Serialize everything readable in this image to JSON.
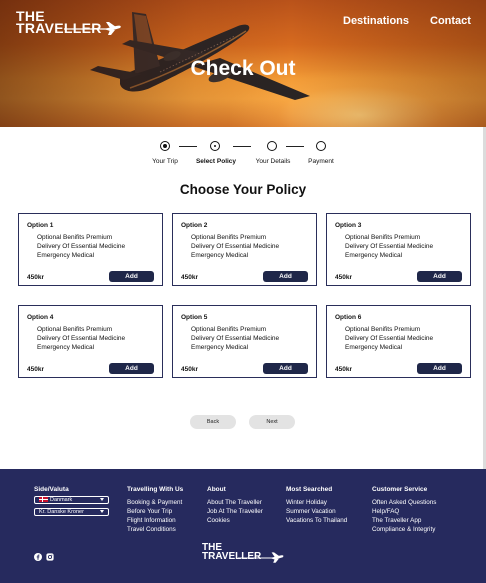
{
  "brand": {
    "line1": "THE",
    "line2": "TRAVELLER"
  },
  "nav": {
    "destinations": "Destinations",
    "contact": "Contact"
  },
  "hero": {
    "title": "Check Out"
  },
  "steps": [
    {
      "label": "Your Trip",
      "state": "done"
    },
    {
      "label": "Select Policy",
      "state": "current"
    },
    {
      "label": "Your Details",
      "state": "todo"
    },
    {
      "label": "Payment",
      "state": "todo"
    }
  ],
  "section_title": "Choose Your Policy",
  "options": [
    {
      "title": "Option 1",
      "features": [
        "Optional Benifits Premium",
        "Delivery Of Essential Medicine",
        "Emergency Medical"
      ],
      "price": "450kr",
      "button": "Add"
    },
    {
      "title": "Option 2",
      "features": [
        "Optional Benifits Premium",
        "Delivery Of Essential Medicine",
        "Emergency Medical"
      ],
      "price": "450kr",
      "button": "Add"
    },
    {
      "title": "Option 3",
      "features": [
        "Optional Benifits Premium",
        "Delivery Of Essential Medicine",
        "Emergency Medical"
      ],
      "price": "450kr",
      "button": "Add"
    },
    {
      "title": "Option 4",
      "features": [
        "Optional Benifits Premium",
        "Delivery Of Essential Medicine",
        "Emergency Medical"
      ],
      "price": "450kr",
      "button": "Add"
    },
    {
      "title": "Option 5",
      "features": [
        "Optional Benifits Premium",
        "Delivery Of Essential Medicine",
        "Emergency Medical"
      ],
      "price": "450kr",
      "button": "Add"
    },
    {
      "title": "Option 6",
      "features": [
        "Optional Benifits Premium",
        "Delivery Of Essential Medicine",
        "Emergency Medical"
      ],
      "price": "450kr",
      "button": "Add"
    }
  ],
  "buttons": {
    "back": "Back",
    "next": "Next"
  },
  "footer": {
    "side": {
      "heading": "Side/Valuta",
      "country": "Danmark",
      "currency": "Kr. Danske Kroner"
    },
    "travelling": {
      "heading": "Travelling With Us",
      "links": [
        "Booking & Payment",
        "Before Your Trip",
        "Flight Information",
        "Travel Conditions"
      ]
    },
    "about": {
      "heading": "About",
      "links": [
        "About The Traveller",
        "Job At The Traveller",
        "Cookies"
      ]
    },
    "searched": {
      "heading": "Most Searched",
      "links": [
        "Winter Holiday",
        "Summer Vacation",
        "Vacations To Thailand"
      ]
    },
    "service": {
      "heading": "Customer Service",
      "links": [
        "Often Asked Questions",
        "Help/FAQ",
        "The Traveller App",
        "Compliance & Integrity"
      ]
    }
  },
  "colors": {
    "navy": "#262a5e",
    "button": "#1f2749",
    "card_border": "#2a2e5a"
  },
  "icons": [
    "plane-icon",
    "facebook-icon",
    "instagram-icon",
    "danish-flag-icon",
    "caret-down-icon"
  ]
}
